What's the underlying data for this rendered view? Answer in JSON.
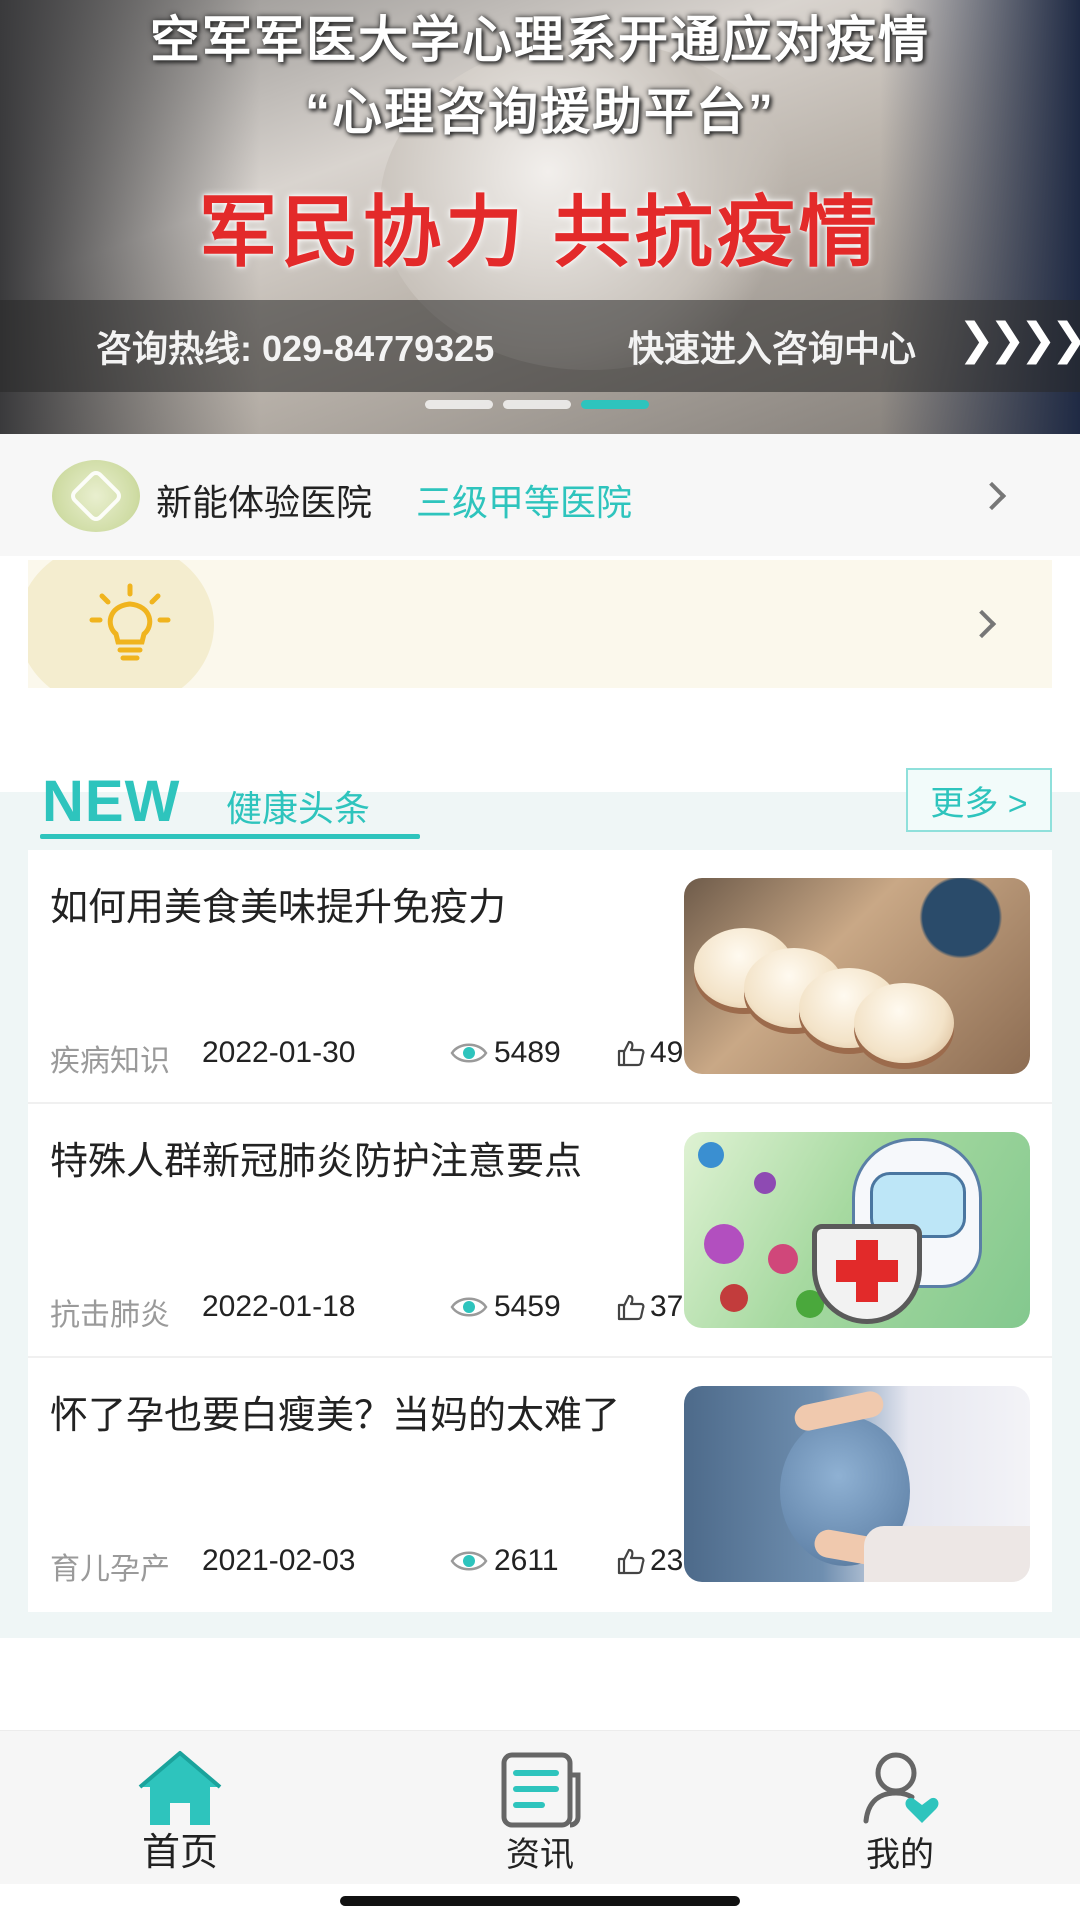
{
  "banner": {
    "line1": "空军军医大学心理系开通应对疫情",
    "line2": "“心理咨询援助平台”",
    "slogan": "军民协力  共抗疫情",
    "hotline": "咨询热线: 029-84779325",
    "enter": "快速进入咨询中心",
    "arrows": "❯❯❯❯",
    "page_count": 3,
    "active_index": 2
  },
  "hospital": {
    "name": "新能体验医院",
    "level": "三级甲等医院"
  },
  "news": {
    "heading_en": "NEW",
    "heading": "健康头条",
    "more_label": "更多 >",
    "items": [
      {
        "title": "如何用美食美味提升免疫力",
        "category": "疾病知识",
        "date": "2022-01-30",
        "views": "5489",
        "likes": "49",
        "thumb": "food-photo"
      },
      {
        "title": "特殊人群新冠肺炎防护注意要点",
        "category": "抗击肺炎",
        "date": "2022-01-18",
        "views": "5459",
        "likes": "37",
        "thumb": "virus-illustration"
      },
      {
        "title": "怀了孕也要白瘦美？当妈的太难了",
        "category": "育儿孕产",
        "date": "2021-02-03",
        "views": "2611",
        "likes": "23",
        "thumb": "pregnancy-photo"
      }
    ]
  },
  "nav": {
    "home": "首页",
    "news": "资讯",
    "mine": "我的",
    "active": "home"
  },
  "colors": {
    "accent": "#2ec4bd",
    "slogan_red": "#e32a2a",
    "section_bg": "#eff6f6"
  }
}
